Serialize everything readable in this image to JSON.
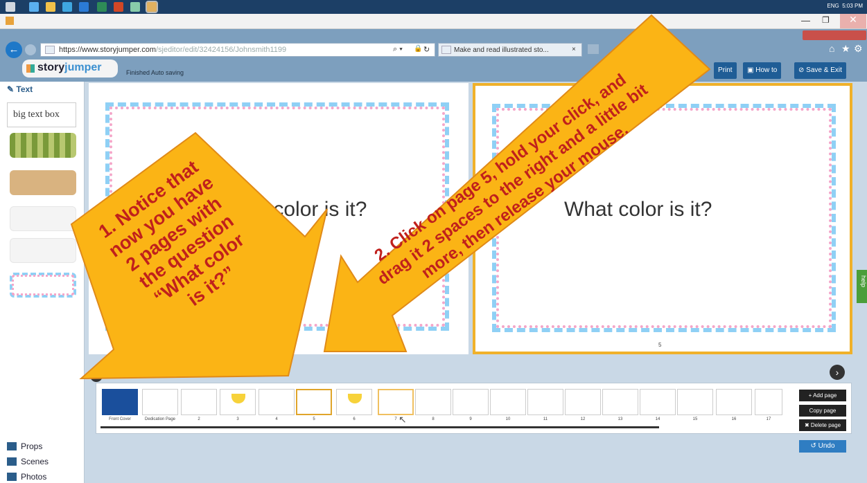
{
  "taskbar": {
    "lang": "ENG",
    "time": "5:03 PM"
  },
  "browser": {
    "url_host": "https://www.storyjumper.com",
    "url_path": "/sjeditor/edit/32424156/Johnsmith1199",
    "tab_title": "Make and read illustrated sto...",
    "tab_close": "×"
  },
  "app": {
    "logo_a": "story",
    "logo_b": "jumper",
    "autosave": "Finished Auto saving",
    "buttons": {
      "print": "Print",
      "howto": "How to",
      "save": "Save & Exit"
    }
  },
  "leftpanel": {
    "header": "Text",
    "big_text_box": "big text box",
    "props": "Props",
    "scenes": "Scenes",
    "photos": "Photos"
  },
  "pages": {
    "left_text": "What color is it?",
    "right_text": "What color is it?",
    "right_page_number": "5"
  },
  "thumbnails": {
    "labels": [
      "Front Cover",
      "Dedication Page",
      "2",
      "3",
      "4",
      "5",
      "6",
      "7",
      "8",
      "9",
      "10",
      "11",
      "12",
      "13",
      "14",
      "15",
      "16",
      "17"
    ]
  },
  "side_buttons": {
    "add": "+ Add page",
    "copy": "Copy page",
    "delete": "✖ Delete page",
    "undo": "Undo"
  },
  "help": "help",
  "annotations": {
    "note1": [
      "1. Notice that",
      "now you have",
      "2 pages with",
      "the question",
      "“What color",
      "is it?”"
    ],
    "note2": [
      "2. Click on page 5, hold your click, and",
      "drag it 2 spaces to the right and a little bit",
      "more, then release your mouse."
    ]
  },
  "colors": {
    "accent": "#1f5d96",
    "annotation_fill": "#fbb415",
    "annotation_text": "#c0201c",
    "help": "#4a9e3a"
  }
}
